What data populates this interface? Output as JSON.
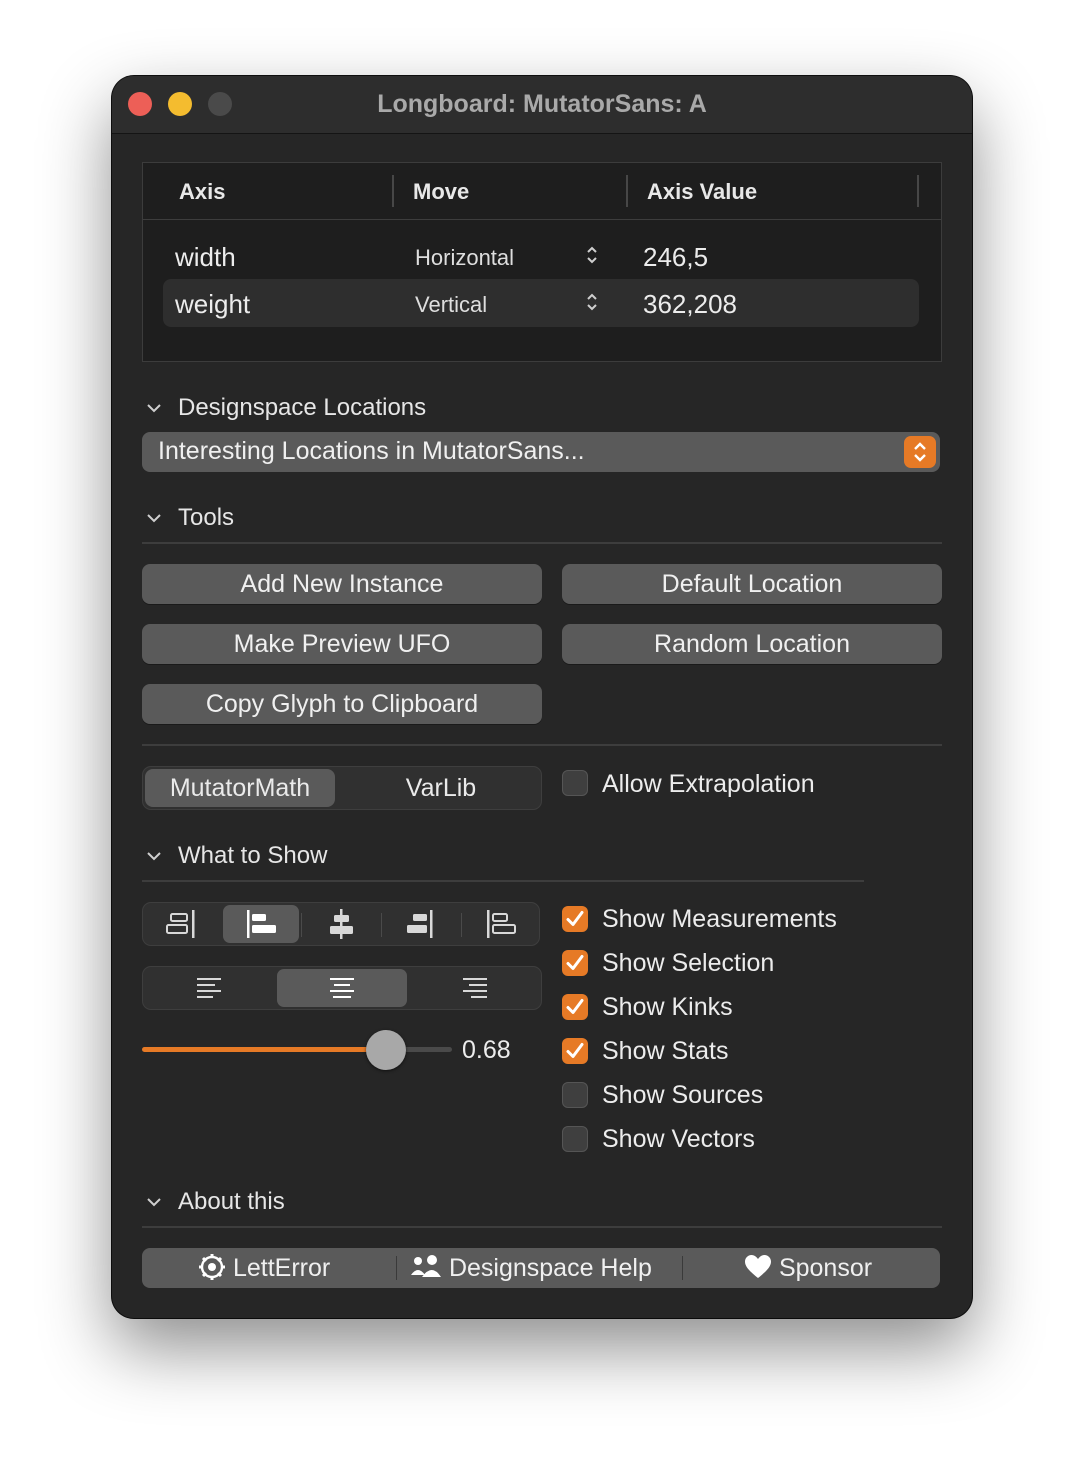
{
  "window": {
    "title": "Longboard: MutatorSans: A"
  },
  "axes_table": {
    "headers": [
      "Axis",
      "Move",
      "Axis Value"
    ],
    "rows": [
      {
        "axis": "width",
        "move": "Horizontal",
        "value": "246,5"
      },
      {
        "axis": "weight",
        "move": "Vertical",
        "value": "362,208"
      }
    ]
  },
  "designspace": {
    "header": "Designspace Locations",
    "popup_value": "Interesting Locations in MutatorSans..."
  },
  "tools": {
    "header": "Tools",
    "add_new_instance": "Add New Instance",
    "default_location": "Default Location",
    "make_preview_ufo": "Make Preview UFO",
    "random_location": "Random Location",
    "copy_glyph": "Copy Glyph to Clipboard",
    "engine_options": [
      "MutatorMath",
      "VarLib"
    ],
    "engine_selected": "MutatorMath",
    "allow_extrapolation": {
      "label": "Allow Extrapolation",
      "checked": false
    }
  },
  "what_to_show": {
    "header": "What to Show",
    "alignment_icons": [
      "align-right-bars-icon",
      "align-left-bars-icon",
      "align-center-bars-icon",
      "align-right-filled-icon",
      "align-left-outline-icon"
    ],
    "alignment_selected": 1,
    "text_align_icons": [
      "text-align-left-icon",
      "text-align-center-icon",
      "text-align-right-icon"
    ],
    "text_align_selected": 1,
    "slider": {
      "value": 0.68,
      "label": "0.68"
    },
    "options": [
      {
        "label": "Show Measurements",
        "checked": true
      },
      {
        "label": "Show Selection",
        "checked": true
      },
      {
        "label": "Show Kinks",
        "checked": true
      },
      {
        "label": "Show Stats",
        "checked": true
      },
      {
        "label": "Show Sources",
        "checked": false
      },
      {
        "label": "Show Vectors",
        "checked": false
      }
    ]
  },
  "about": {
    "header": "About this",
    "links": [
      {
        "label": "LettError",
        "icon": "gear-icon"
      },
      {
        "label": "Designspace Help",
        "icon": "people-icon"
      },
      {
        "label": "Sponsor",
        "icon": "heart-icon"
      }
    ]
  },
  "colors": {
    "accent": "#e67a26",
    "window_bg": "#262626",
    "button_bg": "#5a5a5a"
  }
}
